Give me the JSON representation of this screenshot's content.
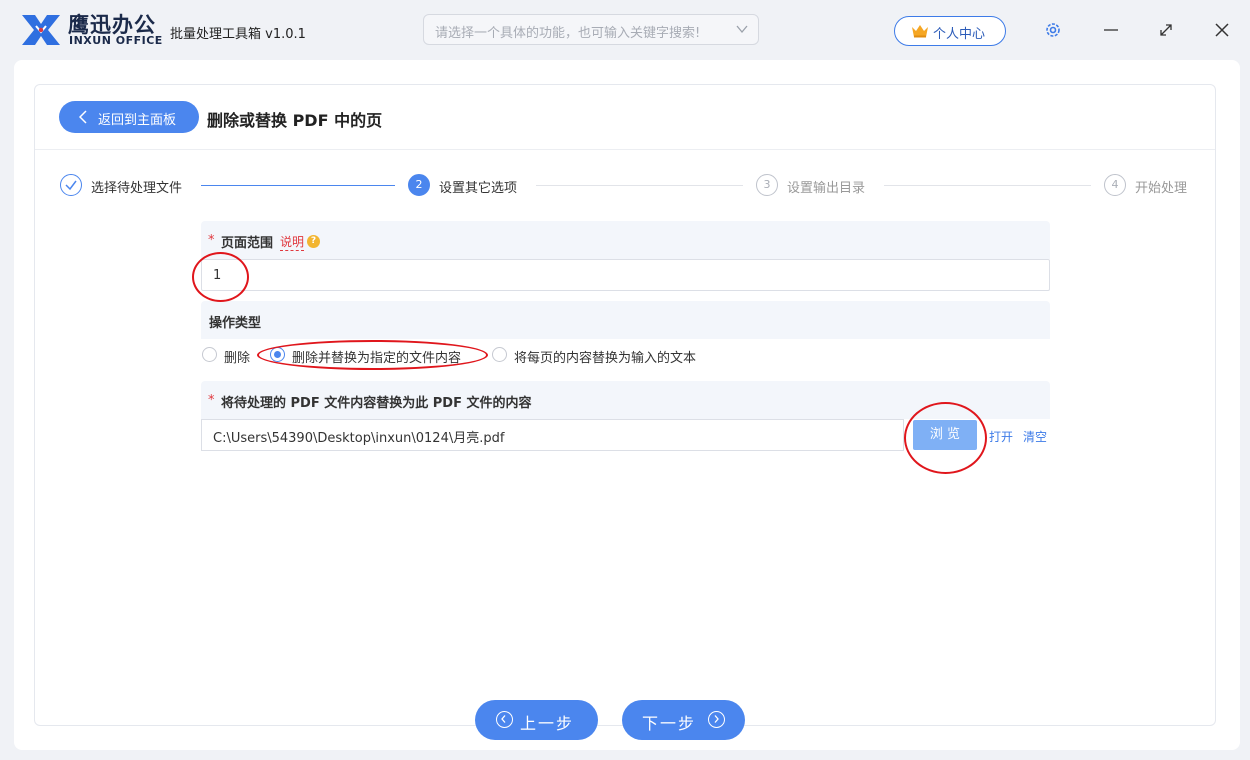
{
  "app": {
    "brand_cn": "鹰迅办公",
    "brand_en": "INXUN OFFICE",
    "title": "批量处理工具箱 v1.0.1",
    "search_placeholder": "请选择一个具体的功能，也可输入关键字搜索!",
    "user_center_label": "个人中心",
    "icons": {
      "logo": "x-logo-icon",
      "chevron": "chevron-down-icon",
      "crown": "crown-icon",
      "settings": "gear-icon",
      "minimize": "minimize-icon",
      "maximize": "maximize-icon",
      "close": "close-icon"
    }
  },
  "header": {
    "back_label": "返回到主面板",
    "page_title": "删除或替换 PDF 中的页"
  },
  "steps": [
    {
      "num": "✓",
      "label": "选择待处理文件",
      "state": "done"
    },
    {
      "num": "2",
      "label": "设置其它选项",
      "state": "active"
    },
    {
      "num": "3",
      "label": "设置输出目录",
      "state": "pending"
    },
    {
      "num": "4",
      "label": "开始处理",
      "state": "pending"
    }
  ],
  "form": {
    "page_range": {
      "required_mark": "*",
      "label": "页面范围",
      "help_label": "说明",
      "help_icon": "?",
      "value": "1"
    },
    "operation_type": {
      "label": "操作类型",
      "options": [
        {
          "label": "删除",
          "selected": false
        },
        {
          "label": "删除并替换为指定的文件内容",
          "selected": true
        },
        {
          "label": "将每页的内容替换为输入的文本",
          "selected": false
        }
      ]
    },
    "replacement_file": {
      "required_mark": "*",
      "label": "将待处理的 PDF 文件内容替换为此 PDF 文件的内容",
      "path": "C:\\Users\\54390\\Desktop\\inxun\\0124\\月亮.pdf",
      "browse_label": "浏 览",
      "open_label": "打开",
      "clear_label": "清空"
    }
  },
  "footer": {
    "prev_label": "上一步",
    "next_label": "下一步"
  },
  "colors": {
    "accent": "#4b86ee",
    "annotation": "#e0161c",
    "required": "#e0383e"
  }
}
